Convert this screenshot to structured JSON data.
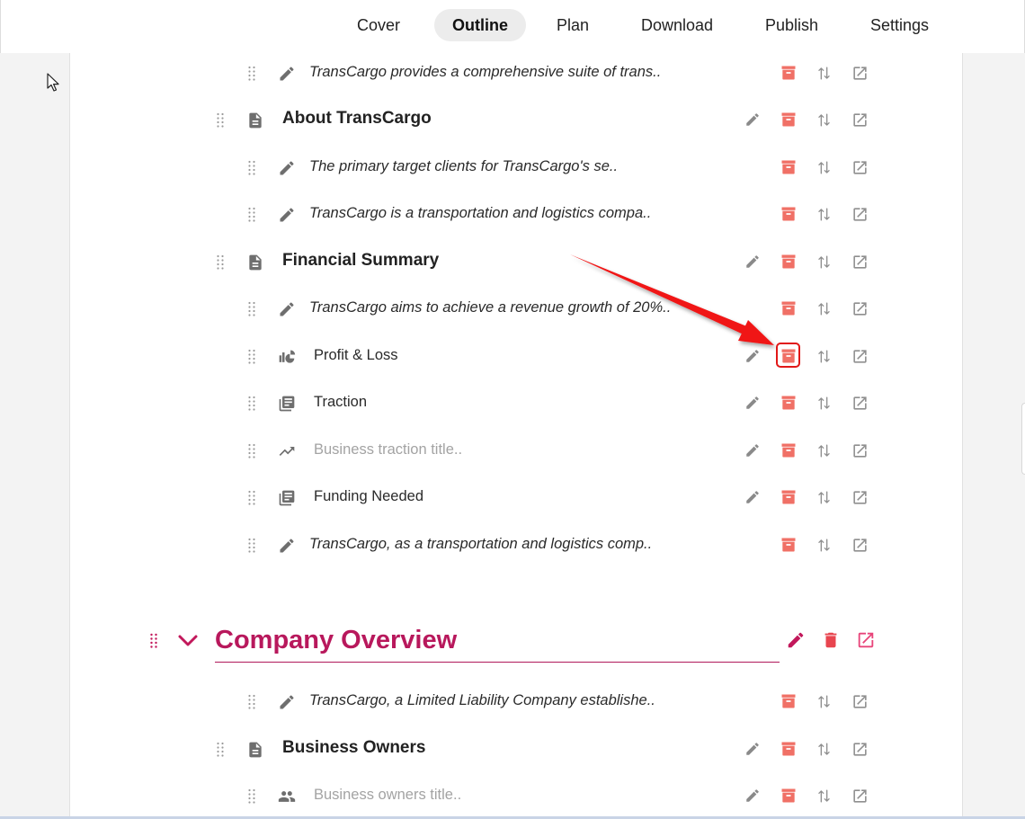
{
  "nav": {
    "tabs": [
      {
        "label": "Cover",
        "active": false
      },
      {
        "label": "Outline",
        "active": true
      },
      {
        "label": "Plan",
        "active": false
      },
      {
        "label": "Download",
        "active": false
      },
      {
        "label": "Publish",
        "active": false
      },
      {
        "label": "Settings",
        "active": false
      }
    ]
  },
  "colors": {
    "accent": "#b8185c",
    "archive": "#f07066",
    "icon_gray": "#8a8a8a",
    "highlight": "#e11818"
  },
  "outline": {
    "rows": [
      {
        "type": "text",
        "icon": "pencil-icon",
        "label": "TransCargo provides a comprehensive suite of trans..",
        "edit": false
      },
      {
        "type": "topic",
        "icon": "document-icon",
        "label": "About TransCargo",
        "edit": true
      },
      {
        "type": "text",
        "icon": "pencil-icon",
        "label": "The primary target clients for TransCargo's se..",
        "edit": false
      },
      {
        "type": "text",
        "icon": "pencil-icon",
        "label": "TransCargo is a transportation and logistics compa..",
        "edit": false
      },
      {
        "type": "topic",
        "icon": "document-icon",
        "label": "Financial Summary",
        "edit": true
      },
      {
        "type": "text",
        "icon": "pencil-icon",
        "label": "TransCargo aims to achieve a revenue growth of 20%..",
        "edit": false
      },
      {
        "type": "chart",
        "icon": "chart-icon",
        "label": "Profit & Loss",
        "edit": true
      },
      {
        "type": "list",
        "icon": "library-icon",
        "label": "Traction",
        "edit": true
      },
      {
        "type": "placeholder",
        "icon": "trending-up-icon",
        "label": "Business traction title..",
        "edit": true
      },
      {
        "type": "list",
        "icon": "library-icon",
        "label": "Funding Needed",
        "edit": true
      },
      {
        "type": "text",
        "icon": "pencil-icon",
        "label": "TransCargo, as a transportation and logistics comp..",
        "edit": false
      }
    ],
    "section": {
      "title": "Company Overview"
    },
    "section_rows": [
      {
        "type": "text",
        "icon": "pencil-icon",
        "label": "TransCargo, a Limited Liability Company establishe..",
        "edit": false
      },
      {
        "type": "topic",
        "icon": "document-icon",
        "label": "Business Owners",
        "edit": true
      },
      {
        "type": "placeholder",
        "icon": "people-icon",
        "label": "Business owners title..",
        "edit": true
      }
    ]
  }
}
